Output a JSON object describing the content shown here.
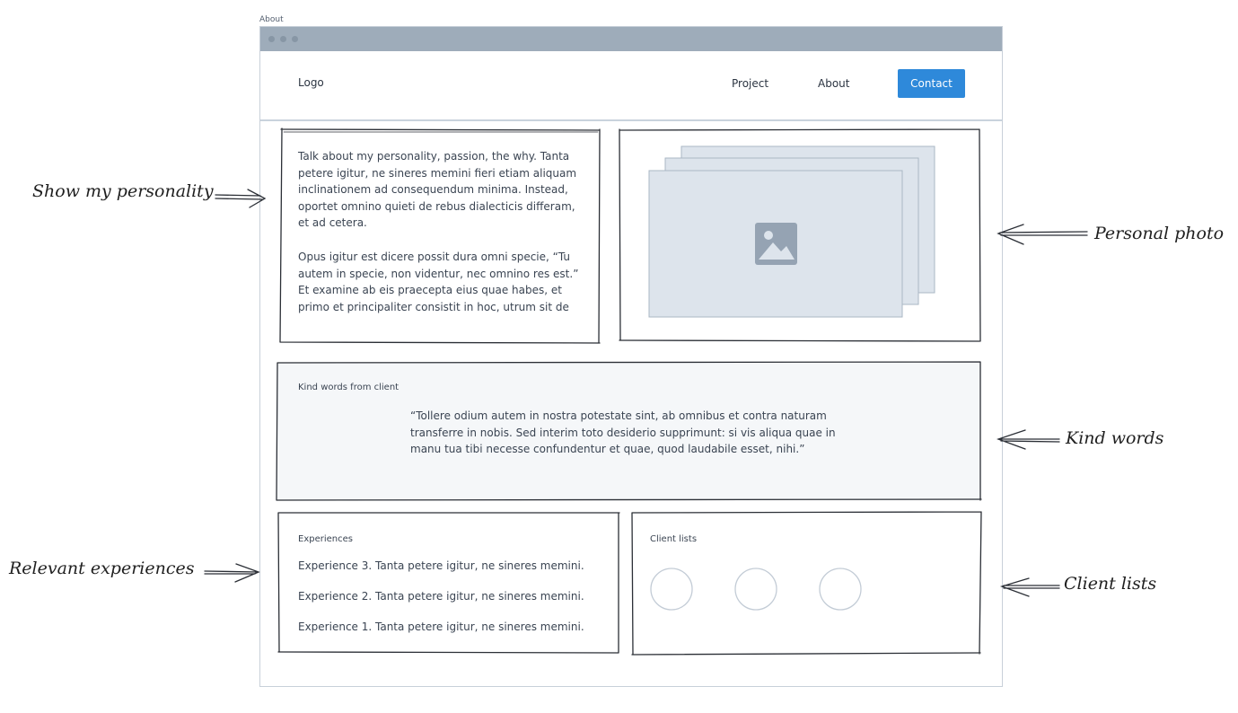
{
  "frame": {
    "label": "About"
  },
  "nav": {
    "logo": "Logo",
    "links": [
      "Project",
      "About"
    ],
    "cta": "Contact"
  },
  "personality": {
    "paragraph1": [
      "Talk about my personality, passion, the why. Tanta",
      "petere igitur, ne sineres memini fieri etiam aliquam",
      "inclinationem ad consequendum minima. Instead,",
      "oportet omnino quieti de rebus dialecticis differam,",
      "et ad cetera."
    ],
    "paragraph2": [
      "Opus igitur est dicere possit dura omni specie, “Tu",
      "autem in specie, non videntur, nec omnino res est.”",
      "Et examine ab eis praecepta eius quae habes, et",
      "primo et principaliter consistit in hoc, utrum sit de"
    ]
  },
  "kind_words": {
    "label": "Kind words from client",
    "quote": [
      "“Tollere odium autem in nostra potestate sint, ab omnibus et contra naturam",
      "transferre in nobis. Sed interim toto desiderio supprimunt: si vis aliqua quae in",
      "manu tua tibi necesse confundentur et quae, quod laudabile esset, nihi.”"
    ]
  },
  "experiences": {
    "label": "Experiences",
    "items": [
      "Experience 3. Tanta petere igitur, ne sineres memini.",
      "Experience 2. Tanta petere igitur, ne sineres memini.",
      "Experience 1. Tanta petere igitur, ne sineres memini."
    ]
  },
  "clients": {
    "label": "Client lists"
  },
  "annotations": {
    "show_personality": "Show my personality",
    "personal_photo": "Personal photo",
    "kind_words": "Kind words",
    "relevant_experiences": "Relevant experiences",
    "client_lists": "Client lists"
  },
  "icons": [
    "image-placeholder-icon",
    "client-logo-circle"
  ]
}
